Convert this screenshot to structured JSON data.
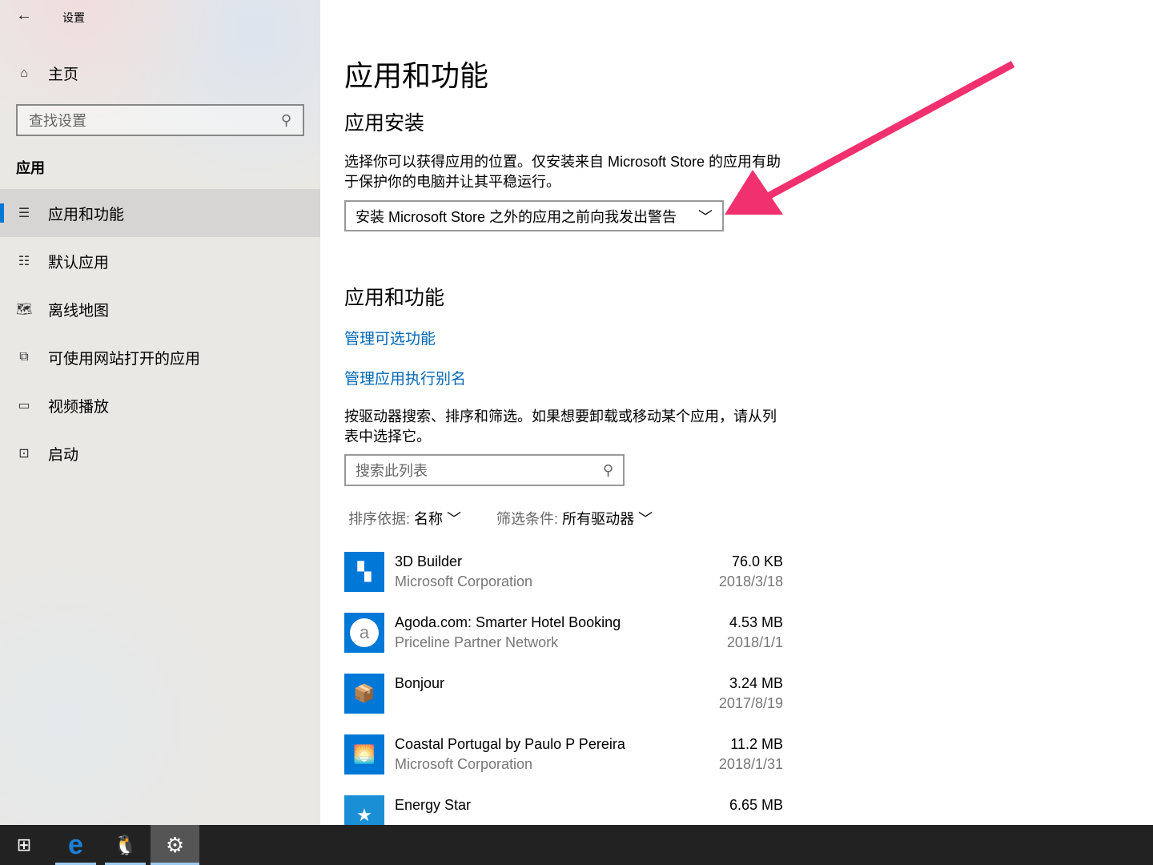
{
  "window": {
    "title": "设置",
    "back": "←"
  },
  "sidebar": {
    "home": "主页",
    "search_placeholder": "查找设置",
    "section": "应用",
    "items": [
      {
        "label": "应用和功能",
        "icon": "☰"
      },
      {
        "label": "默认应用",
        "icon": "☷"
      },
      {
        "label": "离线地图",
        "icon": "🗺"
      },
      {
        "label": "可使用网站打开的应用",
        "icon": "⧉"
      },
      {
        "label": "视频播放",
        "icon": "▭"
      },
      {
        "label": "启动",
        "icon": "⊡"
      }
    ]
  },
  "main": {
    "title": "应用和功能",
    "install_heading": "应用安装",
    "install_desc": "选择你可以获得应用的位置。仅安装来自 Microsoft Store 的应用有助于保护你的电脑并让其平稳运行。",
    "install_dropdown": "安装 Microsoft Store 之外的应用之前向我发出警告",
    "features_heading": "应用和功能",
    "link_optional": "管理可选功能",
    "link_alias": "管理应用执行别名",
    "list_desc": "按驱动器搜索、排序和筛选。如果想要卸载或移动某个应用，请从列表中选择它。",
    "list_search_placeholder": "搜索此列表",
    "sort_label": "排序依据:",
    "sort_value": "名称",
    "filter_label": "筛选条件:",
    "filter_value": "所有驱动器",
    "apps": [
      {
        "name": "3D Builder",
        "publisher": "Microsoft Corporation",
        "size": "76.0 KB",
        "date": "2018/3/18",
        "icon": "▚"
      },
      {
        "name": "Agoda.com: Smarter Hotel Booking",
        "publisher": "Priceline Partner Network",
        "size": "4.53 MB",
        "date": "2018/1/1",
        "icon": "a"
      },
      {
        "name": "Bonjour",
        "publisher": "",
        "size": "3.24 MB",
        "date": "2017/8/19",
        "icon": "📦"
      },
      {
        "name": "Coastal Portugal by Paulo P Pereira",
        "publisher": "Microsoft Corporation",
        "size": "11.2 MB",
        "date": "2018/1/31",
        "icon": "🌅"
      },
      {
        "name": "Energy Star",
        "publisher": "",
        "size": "6.65 MB",
        "date": "",
        "icon": "★"
      }
    ]
  },
  "colors": {
    "accent": "#0078d7",
    "link": "#0067b8",
    "arrow": "#f0306f",
    "taskbar": "#222222"
  },
  "taskbar": {
    "items": [
      "start",
      "edge",
      "qq",
      "settings"
    ]
  }
}
